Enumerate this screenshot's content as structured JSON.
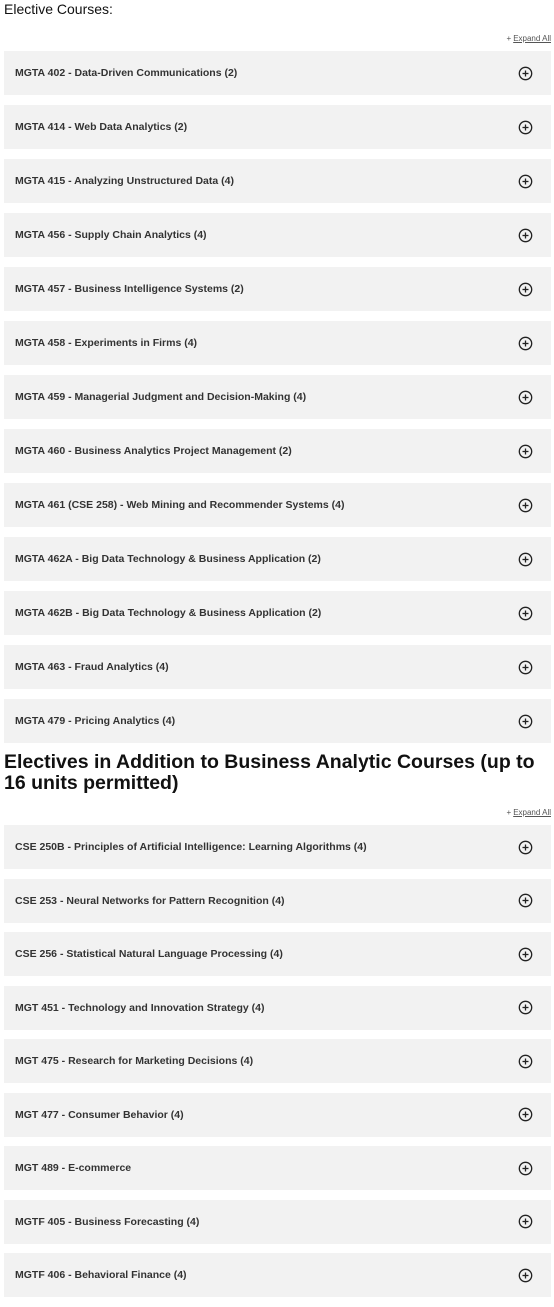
{
  "section1": {
    "title": "Elective Courses:",
    "expand_all_prefix": "+",
    "expand_all_label": "Expand All",
    "items": [
      {
        "label": "MGTA 402 - Data-Driven Communications (2)"
      },
      {
        "label": "MGTA 414 - Web Data Analytics (2)"
      },
      {
        "label": "MGTA 415 - Analyzing Unstructured Data (4)"
      },
      {
        "label": "MGTA 456 - Supply Chain Analytics (4)"
      },
      {
        "label": "MGTA 457 - Business Intelligence Systems (2)"
      },
      {
        "label": "MGTA 458 - Experiments in Firms (4)"
      },
      {
        "label": "MGTA 459 - Managerial Judgment and Decision-Making (4)"
      },
      {
        "label": "MGTA 460 - Business Analytics Project Management (2)"
      },
      {
        "label": "MGTA 461 (CSE 258) - Web Mining and Recommender Systems (4)"
      },
      {
        "label": "MGTA 462A - Big Data Technology & Business Application (2)"
      },
      {
        "label": "MGTA 462B - Big Data Technology & Business Application (2)"
      },
      {
        "label": "MGTA 463 - Fraud Analytics (4)"
      },
      {
        "label": "MGTA 479 - Pricing Analytics (4)"
      }
    ]
  },
  "section2": {
    "title": "Electives in Addition to Business Analytic Courses (up to 16 units permitted)",
    "expand_all_prefix": "+",
    "expand_all_label": "Expand All",
    "items": [
      {
        "label": "CSE 250B - Principles of Artificial Intelligence: Learning Algorithms (4)"
      },
      {
        "label": "CSE 253 - Neural Networks for Pattern Recognition (4)"
      },
      {
        "label": "CSE 256 - Statistical Natural Language Processing (4)"
      },
      {
        "label": "MGT 451 - Technology and Innovation Strategy (4)"
      },
      {
        "label": "MGT 475 - Research for Marketing Decisions (4)"
      },
      {
        "label": "MGT 477 - Consumer Behavior (4)"
      },
      {
        "label": "MGT 489 - E-commerce"
      },
      {
        "label": "MGTF 405 - Business Forecasting (4)"
      },
      {
        "label": "MGTF 406 - Behavioral Finance (4)"
      }
    ]
  },
  "icons": {
    "expand_item": "plus-circle-icon"
  }
}
